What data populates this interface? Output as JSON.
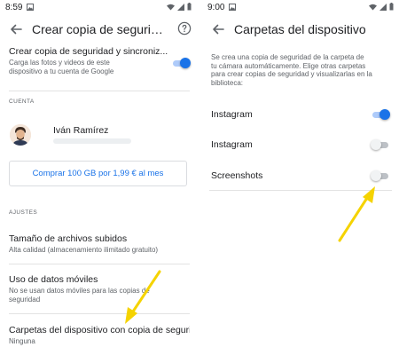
{
  "left": {
    "status": {
      "time": "8:59"
    },
    "appbar": {
      "title": "Crear copia de seguridad y sincronizar"
    },
    "backup": {
      "title": "Crear copia de seguridad y sincroniz...",
      "desc": [
        "Carga las fotos y videos de este",
        "dispositivo a tu cuenta de Google"
      ],
      "enabled": true
    },
    "account": {
      "section": "CUENTA",
      "name": "Iván Ramírez"
    },
    "buy_button": "Comprar 100 GB por 1,99 € al mes",
    "settings": {
      "section": "AJUSTES",
      "items": [
        {
          "title": "Tamaño de archivos subidos",
          "desc": [
            "Alta calidad (almacenamiento ilimitado gratuito)"
          ]
        },
        {
          "title": "Uso de datos móviles",
          "desc": [
            "No se usan datos móviles para las copias de",
            "seguridad"
          ]
        },
        {
          "title": "Carpetas del dispositivo con copia de seguri...",
          "desc": [
            "Ninguna"
          ]
        }
      ]
    }
  },
  "right": {
    "status": {
      "time": "9:00"
    },
    "appbar": {
      "title": "Carpetas del dispositivo"
    },
    "intro": [
      "Se crea una copia de seguridad de la carpeta de",
      "tu cámara automáticamente. Elige otras carpetas",
      "para crear copias de seguridad y visualizarlas en la",
      "biblioteca:"
    ],
    "folders": [
      {
        "name": "Instagram",
        "enabled": true
      },
      {
        "name": "Instagram",
        "enabled": false
      },
      {
        "name": "Screenshots",
        "enabled": false
      }
    ]
  },
  "colors": {
    "accent": "#1a73e8",
    "annotation_arrow": "#f5d300"
  },
  "icons": {
    "back": "arrow-back-icon",
    "help": "help-circle-icon",
    "wifi": "wifi-icon",
    "battery": "battery-icon",
    "signal": "signal-icon",
    "image": "image-icon"
  }
}
